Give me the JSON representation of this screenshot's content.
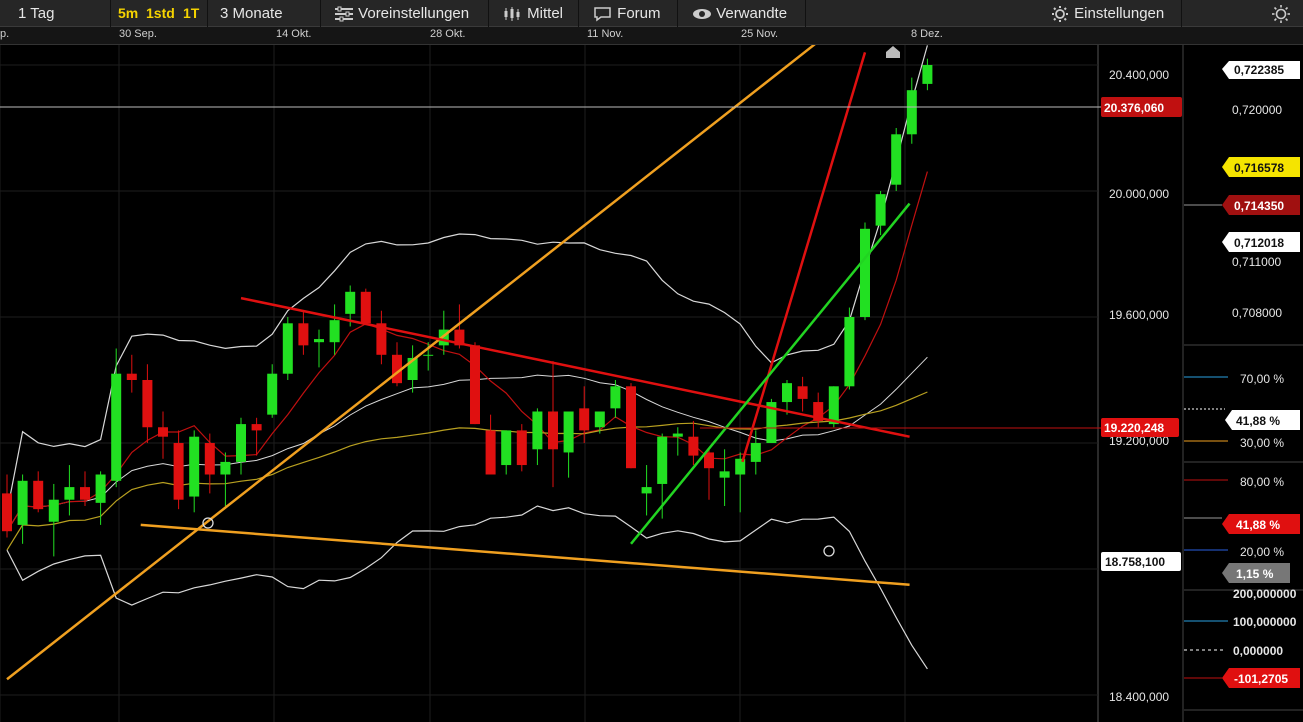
{
  "toolbar": {
    "period": "1 Tag",
    "quick": [
      "5m",
      "1std",
      "1T"
    ],
    "range": "3 Monate",
    "presets": "Voreinstellungen",
    "average": "Mittel",
    "forum": "Forum",
    "related": "Verwandte",
    "settings": "Einstellungen"
  },
  "dates": [
    "p.",
    "30 Sep.",
    "14 Okt.",
    "28 Okt.",
    "11 Nov.",
    "25 Nov.",
    "8 Dez."
  ],
  "price_axis": {
    "ticks": [
      "20.400,000",
      "20.000,000",
      "19.600,000",
      "19.200,000",
      "18.400,000"
    ],
    "last_price": "20.376,060",
    "marker_1": "19.220,248",
    "marker_2": "18.758,100"
  },
  "secondary_axis": {
    "ticks": [
      "0,720000",
      "0,711000",
      "0,708000"
    ],
    "tags": [
      "0,722385",
      "0,716578",
      "0,714350",
      "0,712018"
    ]
  },
  "oscillator_1": {
    "ticks": [
      "70,00 %",
      "30,00 %"
    ],
    "value": "41,88 %"
  },
  "oscillator_2": {
    "ticks": [
      "80,00 %",
      "20,00 %"
    ],
    "values": [
      "41,88 %",
      "1,15 %"
    ]
  },
  "momentum": {
    "ticks": [
      "200,000000",
      "100,000000",
      "0,000000"
    ],
    "value": "-101,2705"
  },
  "colors": {
    "up": "#22e022",
    "down": "#e01010",
    "trend_orange": "#f0a020",
    "trend_red": "#e01010",
    "trend_green": "#22d422"
  },
  "chart_data": {
    "type": "candlestick",
    "x_start": "2024-09-23",
    "ylim": [
      18350000,
      20520000
    ],
    "candles": [
      {
        "o": 19040000,
        "h": 19100000,
        "l": 18900000,
        "c": 18920000
      },
      {
        "o": 18940000,
        "h": 19100000,
        "l": 18880000,
        "c": 19080000
      },
      {
        "o": 19080000,
        "h": 19110000,
        "l": 18980000,
        "c": 18990000
      },
      {
        "o": 18950000,
        "h": 19070000,
        "l": 18840000,
        "c": 19020000
      },
      {
        "o": 19020000,
        "h": 19130000,
        "l": 18970000,
        "c": 19060000
      },
      {
        "o": 19060000,
        "h": 19110000,
        "l": 19000000,
        "c": 19020000
      },
      {
        "o": 19010000,
        "h": 19110000,
        "l": 18940000,
        "c": 19100000
      },
      {
        "o": 19080000,
        "h": 19500000,
        "l": 19060000,
        "c": 19420000
      },
      {
        "o": 19420000,
        "h": 19480000,
        "l": 19360000,
        "c": 19400000
      },
      {
        "o": 19400000,
        "h": 19450000,
        "l": 19200000,
        "c": 19250000
      },
      {
        "o": 19250000,
        "h": 19300000,
        "l": 19150000,
        "c": 19220000
      },
      {
        "o": 19200000,
        "h": 19240000,
        "l": 18990000,
        "c": 19020000
      },
      {
        "o": 19030000,
        "h": 19240000,
        "l": 18980000,
        "c": 19220000
      },
      {
        "o": 19200000,
        "h": 19230000,
        "l": 19040000,
        "c": 19100000
      },
      {
        "o": 19100000,
        "h": 19170000,
        "l": 19000000,
        "c": 19140000
      },
      {
        "o": 19140000,
        "h": 19280000,
        "l": 19100000,
        "c": 19260000
      },
      {
        "o": 19260000,
        "h": 19280000,
        "l": 19160000,
        "c": 19240000
      },
      {
        "o": 19290000,
        "h": 19450000,
        "l": 19280000,
        "c": 19420000
      },
      {
        "o": 19420000,
        "h": 19600000,
        "l": 19400000,
        "c": 19580000
      },
      {
        "o": 19580000,
        "h": 19620000,
        "l": 19480000,
        "c": 19510000
      },
      {
        "o": 19520000,
        "h": 19560000,
        "l": 19440000,
        "c": 19530000
      },
      {
        "o": 19520000,
        "h": 19640000,
        "l": 19480000,
        "c": 19590000
      },
      {
        "o": 19610000,
        "h": 19700000,
        "l": 19570000,
        "c": 19680000
      },
      {
        "o": 19680000,
        "h": 19690000,
        "l": 19580000,
        "c": 19580000
      },
      {
        "o": 19580000,
        "h": 19620000,
        "l": 19450000,
        "c": 19480000
      },
      {
        "o": 19480000,
        "h": 19520000,
        "l": 19380000,
        "c": 19390000
      },
      {
        "o": 19400000,
        "h": 19510000,
        "l": 19360000,
        "c": 19470000
      },
      {
        "o": 19480000,
        "h": 19520000,
        "l": 19430000,
        "c": 19480000
      },
      {
        "o": 19510000,
        "h": 19620000,
        "l": 19480000,
        "c": 19560000
      },
      {
        "o": 19560000,
        "h": 19640000,
        "l": 19500000,
        "c": 19510000
      },
      {
        "o": 19510000,
        "h": 19520000,
        "l": 19260000,
        "c": 19260000
      },
      {
        "o": 19240000,
        "h": 19290000,
        "l": 19100000,
        "c": 19100000
      },
      {
        "o": 19130000,
        "h": 19240000,
        "l": 19100000,
        "c": 19240000
      },
      {
        "o": 19240000,
        "h": 19260000,
        "l": 19110000,
        "c": 19130000
      },
      {
        "o": 19180000,
        "h": 19310000,
        "l": 19130000,
        "c": 19300000
      },
      {
        "o": 19300000,
        "h": 19460000,
        "l": 19060000,
        "c": 19180000
      },
      {
        "o": 19170000,
        "h": 19300000,
        "l": 19090000,
        "c": 19300000
      },
      {
        "o": 19310000,
        "h": 19380000,
        "l": 19200000,
        "c": 19240000
      },
      {
        "o": 19250000,
        "h": 19300000,
        "l": 19230000,
        "c": 19300000
      },
      {
        "o": 19310000,
        "h": 19400000,
        "l": 19280000,
        "c": 19380000
      },
      {
        "o": 19380000,
        "h": 19390000,
        "l": 19120000,
        "c": 19120000
      },
      {
        "o": 19040000,
        "h": 19130000,
        "l": 18970000,
        "c": 19060000
      },
      {
        "o": 19070000,
        "h": 19230000,
        "l": 18960000,
        "c": 19220000
      },
      {
        "o": 19220000,
        "h": 19250000,
        "l": 19160000,
        "c": 19230000
      },
      {
        "o": 19220000,
        "h": 19270000,
        "l": 19130000,
        "c": 19160000
      },
      {
        "o": 19170000,
        "h": 19180000,
        "l": 19020000,
        "c": 19120000
      },
      {
        "o": 19090000,
        "h": 19180000,
        "l": 19000000,
        "c": 19110000
      },
      {
        "o": 19100000,
        "h": 19170000,
        "l": 18980000,
        "c": 19150000
      },
      {
        "o": 19140000,
        "h": 19240000,
        "l": 19100000,
        "c": 19200000
      },
      {
        "o": 19200000,
        "h": 19340000,
        "l": 19200000,
        "c": 19330000
      },
      {
        "o": 19330000,
        "h": 19400000,
        "l": 19290000,
        "c": 19390000
      },
      {
        "o": 19380000,
        "h": 19410000,
        "l": 19300000,
        "c": 19340000
      },
      {
        "o": 19330000,
        "h": 19360000,
        "l": 19250000,
        "c": 19270000
      },
      {
        "o": 19260000,
        "h": 19380000,
        "l": 19250000,
        "c": 19380000
      },
      {
        "o": 19380000,
        "h": 19630000,
        "l": 19370000,
        "c": 19600000
      },
      {
        "o": 19600000,
        "h": 19900000,
        "l": 19590000,
        "c": 19880000
      },
      {
        "o": 19890000,
        "h": 20000000,
        "l": 19860000,
        "c": 19990000
      },
      {
        "o": 20020000,
        "h": 20200000,
        "l": 20000000,
        "c": 20180000
      },
      {
        "o": 20180000,
        "h": 20360000,
        "l": 20150000,
        "c": 20320000
      },
      {
        "o": 20340000,
        "h": 20420000,
        "l": 20320000,
        "c": 20400000
      }
    ],
    "trendlines": [
      {
        "color": "orange",
        "from": [
          "2024-09-23",
          18450000
        ],
        "to": [
          "2024-12-05",
          20480000
        ]
      },
      {
        "color": "orange",
        "from": [
          "2024-10-05",
          18940000
        ],
        "to": [
          "2024-12-13",
          18750000
        ]
      },
      {
        "color": "red",
        "from": [
          "2024-10-14",
          19660000
        ],
        "to": [
          "2024-12-13",
          19220000
        ]
      },
      {
        "color": "red",
        "from": [
          "2024-11-28",
          19140000
        ],
        "to": [
          "2024-12-09",
          20440000
        ]
      },
      {
        "color": "green",
        "from": [
          "2024-11-18",
          18880000
        ],
        "to": [
          "2024-12-13",
          19960000
        ]
      }
    ]
  }
}
